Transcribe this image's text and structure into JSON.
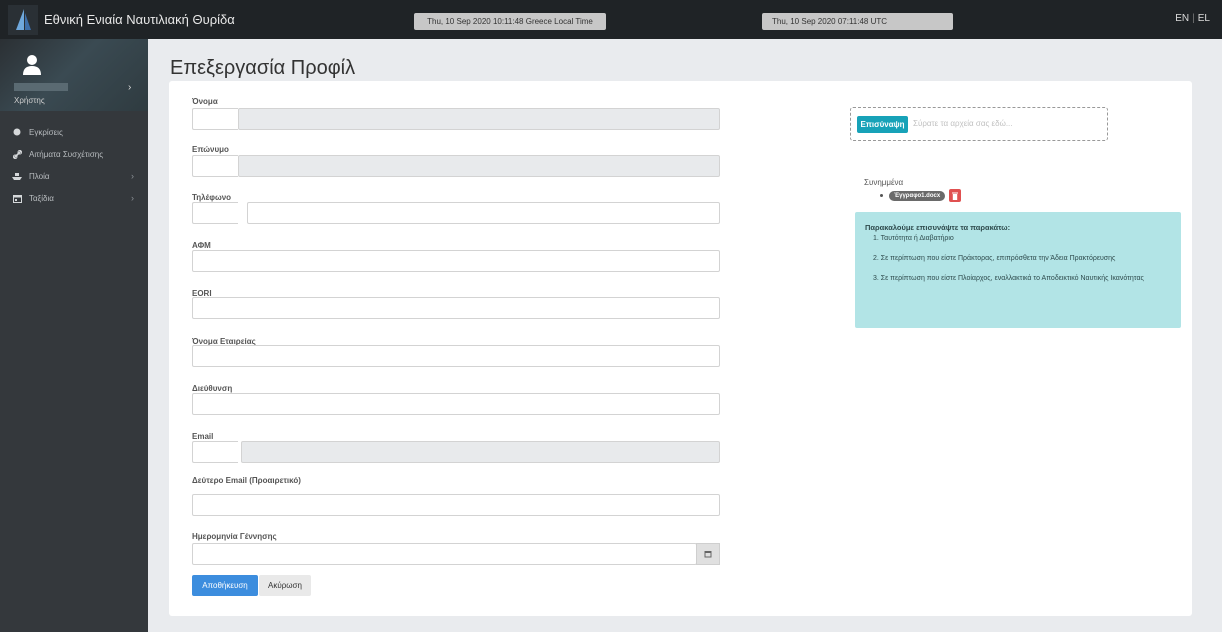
{
  "header": {
    "brand": "Εθνική Ενιαία Ναυτιλιακή Θυρίδα",
    "local_time": "Thu, 10 Sep 2020 10:11:48 Greece Local Time",
    "utc_time": "Thu, 10 Sep 2020 07:11:48 UTC",
    "lang_en": "EN",
    "lang_sep": "|",
    "lang_el": "EL"
  },
  "sidebar": {
    "user_label": "Χρήστης",
    "items": [
      {
        "label": "Εγκρίσεις",
        "icon": "circle-icon"
      },
      {
        "label": "Αιτήματα Συσχέτισης",
        "icon": "link-icon"
      },
      {
        "label": "Πλοία",
        "icon": "ship-icon"
      },
      {
        "label": "Ταξίδια",
        "icon": "calendar-icon"
      }
    ]
  },
  "page": {
    "title": "Επεξεργασία Προφίλ"
  },
  "form": {
    "labels": {
      "first_name": "Όνομα",
      "last_name": "Επώνυμο",
      "phone": "Τηλέφωνο",
      "afm": "ΑΦΜ",
      "eori": "EORI",
      "company": "Όνομα Εταιρείας",
      "address": "Διεύθυνση",
      "email": "Email",
      "second_email": "Δεύτερο Email (Προαιρετικό)",
      "birth_date": "Ημερομηνία Γέννησης"
    },
    "save_label": "Αποθήκευση",
    "cancel_label": "Ακύρωση"
  },
  "upload": {
    "attach_label": "Επισύναψη",
    "placeholder": "Σύρατε τα αρχεία σας εδώ...",
    "attached_title": "Συνημμένα",
    "files": [
      "Έγγραφο1.docx"
    ]
  },
  "info": {
    "title": "Παρακαλούμε επισυνάψτε τα παρακάτω:",
    "line1": "1. Ταυτότητα ή Διαβατήριο",
    "line2": "2. Σε περίπτωση που είστε Πράκτορας, επιπρόσθετα την Άδεια Πρακτόρευσης",
    "line3": "3. Σε περίπτωση που είστε Πλοίαρχος, εναλλακτικά το Αποδεικτικό Ναυτικής Ικανότητας"
  },
  "colors": {
    "topbar": "#1f2326",
    "sidebar": "#34383c",
    "primary": "#3c8dde",
    "attach": "#17a2b8",
    "info_bg": "#b2e4e6",
    "danger": "#e05050"
  }
}
